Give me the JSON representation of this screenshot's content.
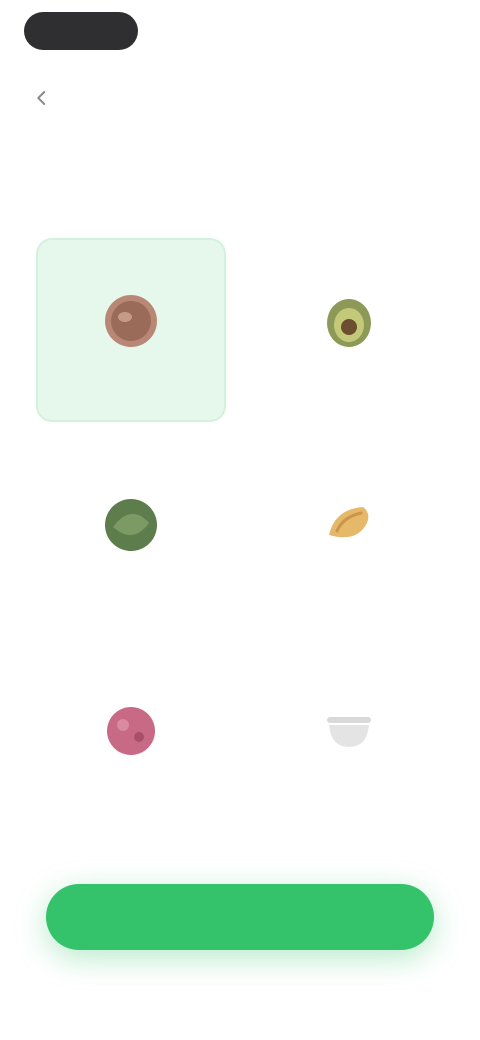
{
  "status_bar": {
    "indicator": "pill"
  },
  "header": {
    "back_icon": "chevron-left-icon",
    "title": ""
  },
  "options": [
    {
      "label": "",
      "selected": true,
      "icon": "meat-icon",
      "color": "#9b6b5a"
    },
    {
      "label": "",
      "selected": false,
      "icon": "avocado-icon",
      "color": "#7a8a4c"
    },
    {
      "label": "",
      "selected": false,
      "icon": "leaf-icon",
      "color": "#5d7d4d"
    },
    {
      "label": "",
      "selected": false,
      "icon": "bread-icon",
      "color": "#e6b86a"
    },
    {
      "label": "",
      "selected": false,
      "icon": "berry-icon",
      "color": "#c86a86"
    },
    {
      "label": "",
      "selected": false,
      "icon": "bowl-icon",
      "color": "#cfcfcf"
    }
  ],
  "cta": {
    "label": ""
  },
  "colors": {
    "accent": "#34c26a",
    "selected_bg": "#e6f8ec",
    "text": "#2a2a2a"
  }
}
